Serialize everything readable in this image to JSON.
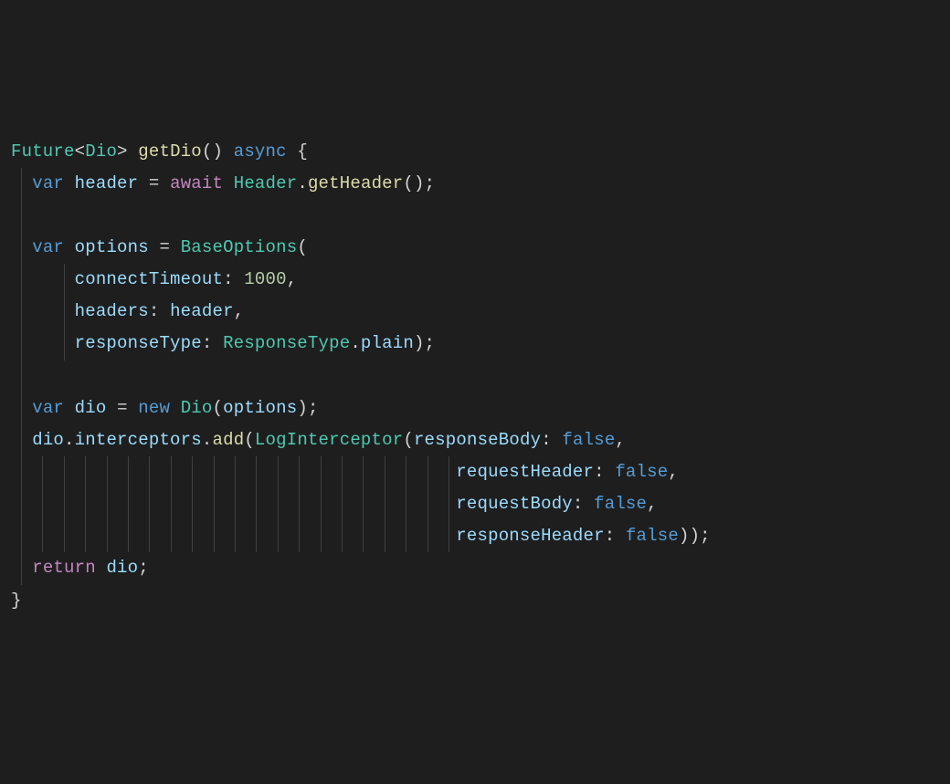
{
  "code": {
    "line1_type": "Future",
    "line1_lt": "<",
    "line1_generic": "Dio",
    "line1_gt": ">",
    "line1_sp1": " ",
    "line1_func": "getDio",
    "line1_parens": "()",
    "line1_sp2": " ",
    "line1_async": "async",
    "line1_sp3": " ",
    "line1_brace": "{",
    "line2_indent": "  ",
    "line2_var": "var",
    "line2_sp1": " ",
    "line2_ident": "header",
    "line2_sp2": " ",
    "line2_eq": "=",
    "line2_sp3": " ",
    "line2_await": "await",
    "line2_sp4": " ",
    "line2_class": "Header",
    "line2_dot": ".",
    "line2_method": "getHeader",
    "line2_parens": "()",
    "line2_semi": ";",
    "line4_indent": "  ",
    "line4_var": "var",
    "line4_sp1": " ",
    "line4_ident": "options",
    "line4_sp2": " ",
    "line4_eq": "=",
    "line4_sp3": " ",
    "line4_class": "BaseOptions",
    "line4_paren": "(",
    "line5_indent": "      ",
    "line5_prop": "connectTimeout",
    "line5_colon": ":",
    "line5_sp": " ",
    "line5_num": "1000",
    "line5_comma": ",",
    "line6_indent": "      ",
    "line6_prop": "headers",
    "line6_colon": ":",
    "line6_sp": " ",
    "line6_val": "header",
    "line6_comma": ",",
    "line7_indent": "      ",
    "line7_prop": "responseType",
    "line7_colon": ":",
    "line7_sp": " ",
    "line7_class": "ResponseType",
    "line7_dot": ".",
    "line7_val": "plain",
    "line7_paren": ")",
    "line7_semi": ";",
    "line9_indent": "  ",
    "line9_var": "var",
    "line9_sp1": " ",
    "line9_ident": "dio",
    "line9_sp2": " ",
    "line9_eq": "=",
    "line9_sp3": " ",
    "line9_new": "new",
    "line9_sp4": " ",
    "line9_class": "Dio",
    "line9_paren_o": "(",
    "line9_arg": "options",
    "line9_paren_c": ")",
    "line9_semi": ";",
    "line10_indent": "  ",
    "line10_ident": "dio",
    "line10_dot1": ".",
    "line10_prop": "interceptors",
    "line10_dot2": ".",
    "line10_method": "add",
    "line10_paren_o": "(",
    "line10_class": "LogInterceptor",
    "line10_paren_o2": "(",
    "line10_argprop": "responseBody",
    "line10_colon": ":",
    "line10_sp": " ",
    "line10_bool": "false",
    "line10_comma": ",",
    "line11_indent": "                                          ",
    "line11_prop": "requestHeader",
    "line11_colon": ":",
    "line11_sp": " ",
    "line11_bool": "false",
    "line11_comma": ",",
    "line12_indent": "                                          ",
    "line12_prop": "requestBody",
    "line12_colon": ":",
    "line12_sp": " ",
    "line12_bool": "false",
    "line12_comma": ",",
    "line13_indent": "                                          ",
    "line13_prop": "responseHeader",
    "line13_colon": ":",
    "line13_sp": " ",
    "line13_bool": "false",
    "line13_paren1": ")",
    "line13_paren2": ")",
    "line13_semi": ";",
    "line14_indent": "  ",
    "line14_return": "return",
    "line14_sp": " ",
    "line14_ident": "dio",
    "line14_semi": ";",
    "line15_brace": "}"
  }
}
